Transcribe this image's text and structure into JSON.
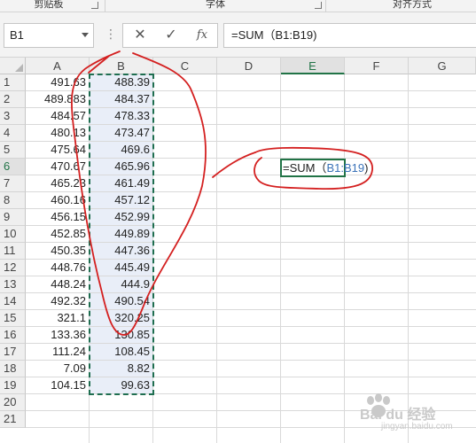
{
  "ribbon": {
    "groups": [
      "剪贴板",
      "字体",
      "对齐方式"
    ]
  },
  "formula_bar": {
    "name_box": "B1",
    "cancel_symbol": "✕",
    "enter_symbol": "✓",
    "fx_label": "fx",
    "formula": "=SUM（B1:B19)"
  },
  "sheet": {
    "columns": [
      "A",
      "B",
      "C",
      "D",
      "E",
      "F",
      "G"
    ],
    "rows": [
      "1",
      "2",
      "3",
      "4",
      "5",
      "6",
      "7",
      "8",
      "9",
      "10",
      "11",
      "12",
      "13",
      "14",
      "15",
      "16",
      "17",
      "18",
      "19",
      "20",
      "21"
    ],
    "col_a": [
      "491.63",
      "489.883",
      "484.57",
      "480.13",
      "475.64",
      "470.67",
      "465.23",
      "460.16",
      "456.15",
      "452.85",
      "450.35",
      "448.76",
      "448.24",
      "492.32",
      "321.1",
      "133.36",
      "111.24",
      "7.09",
      "104.15"
    ],
    "col_b": [
      "488.39",
      "484.37",
      "478.33",
      "473.47",
      "469.6",
      "465.96",
      "461.49",
      "457.12",
      "452.99",
      "449.89",
      "447.36",
      "445.49",
      "444.9",
      "490.54",
      "320.25",
      "130.85",
      "108.45",
      "8.82",
      "99.63"
    ],
    "edit_cell": {
      "prefix": "=SUM（",
      "reference": "B1:B19",
      "suffix": ")"
    }
  },
  "colors": {
    "accent": "#217346",
    "annotation": "#d42020",
    "selection_fill": "#e9eef8",
    "reference_text": "#3a72b8"
  },
  "watermark": {
    "text": "Bai du 经验",
    "url": "jingyan.baidu.com"
  }
}
